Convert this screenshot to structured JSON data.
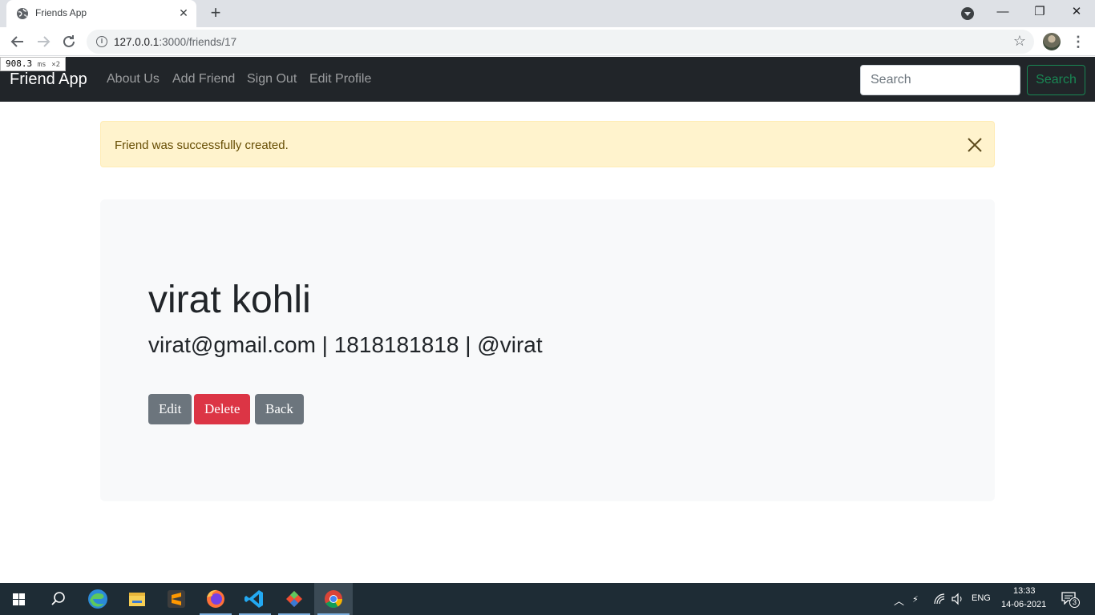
{
  "browser": {
    "tab_title": "Friends App",
    "tab_close": "✕",
    "new_tab": "+",
    "url_host": "127.0.0.1",
    "url_rest": ":3000/friends/17",
    "timing_value": "908.3",
    "timing_unit": "ms",
    "timing_count": "×2",
    "minimize": "—",
    "restore": "❐",
    "close": "✕"
  },
  "navbar": {
    "brand": "Friend App",
    "links": [
      "About Us",
      "Add Friend",
      "Sign Out",
      "Edit Profile"
    ],
    "search_placeholder": "Search",
    "search_button": "Search"
  },
  "alert": {
    "message": "Friend was successfully created."
  },
  "friend": {
    "name": "virat kohli",
    "details": "virat@gmail.com | 1818181818 | @virat",
    "buttons": {
      "edit": "Edit",
      "delete": "Delete",
      "back": "Back"
    }
  },
  "taskbar": {
    "language": "ENG",
    "time": "13:33",
    "date": "14-06-2021",
    "notification_count": "3"
  },
  "colors": {
    "navbar_bg": "#212529",
    "alert_bg": "#fff3cd",
    "danger": "#dc3545",
    "secondary": "#6c757d",
    "success": "#198754"
  }
}
